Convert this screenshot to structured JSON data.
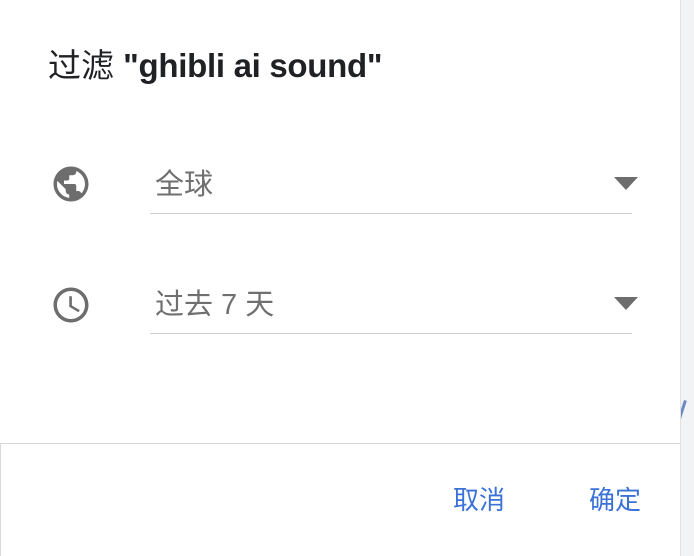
{
  "dialog": {
    "title_prefix": "过滤",
    "title_query": "\"ghibli ai sound\""
  },
  "filters": {
    "region": {
      "icon": "globe-icon",
      "value": "全球"
    },
    "time_range": {
      "icon": "clock-icon",
      "value": "过去 7 天"
    }
  },
  "actions": {
    "cancel_label": "取消",
    "confirm_label": "确定"
  },
  "colors": {
    "accent": "#3b72d8",
    "icon": "#6d6d6d",
    "text_muted": "#6f6f6f",
    "title": "#202124"
  }
}
